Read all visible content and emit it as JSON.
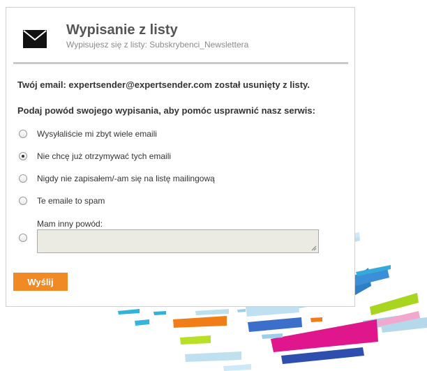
{
  "header": {
    "title": "Wypisanie z listy",
    "subtitle": "Wypisujesz się z listy: Subskrybenci_Newslettera",
    "icon": "mail-icon"
  },
  "main": {
    "email_message": "Twój email: expertsender@expertsender.com został usunięty z listy.",
    "question": "Podaj powód swojego wypisania, aby pomóc usprawnić nasz serwis:",
    "options": [
      {
        "label": "Wysyłaliście mi zbyt wiele emaili",
        "checked": false
      },
      {
        "label": "Nie chcę już otrzymywać tych emaili",
        "checked": true
      },
      {
        "label": "Nigdy nie zapisałem/-am się na listę mailingową",
        "checked": false
      },
      {
        "label": "Te emaile to spam",
        "checked": false
      }
    ],
    "other_label": "Mam inny powód:",
    "other_value": "",
    "submit_label": "Wyślij"
  },
  "colors": {
    "accent": "#f08a24",
    "title": "#555555",
    "subtitle": "#8a8a8a"
  }
}
